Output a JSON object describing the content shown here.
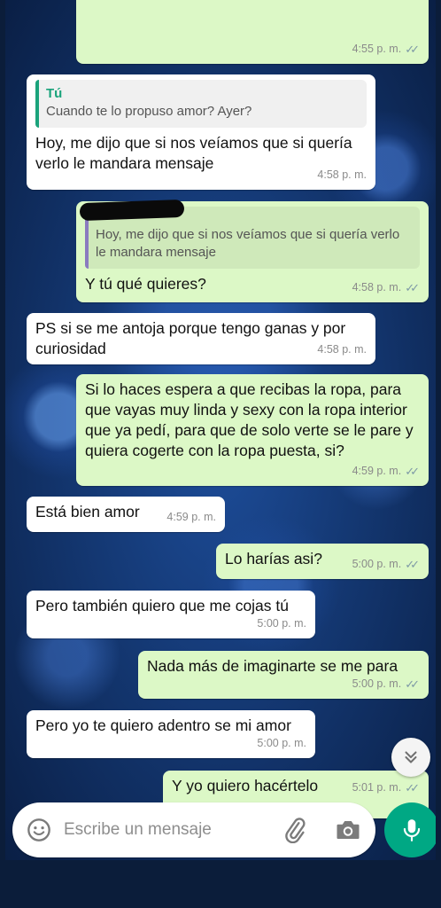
{
  "messages": [
    {
      "id": 0,
      "direction": "out",
      "text": "",
      "time": "4:55 p. m.",
      "partial": true
    },
    {
      "id": 1,
      "direction": "in",
      "quote": {
        "author": "Tú",
        "text": "Cuando te lo propuso amor? Ayer?"
      },
      "text": "Hoy, me dijo que si nos veíamos que si quería verlo le mandara mensaje",
      "time": "4:58 p. m."
    },
    {
      "id": 2,
      "direction": "out",
      "quote": {
        "author": "",
        "text": "Hoy, me dijo que si nos veíamos que si quería verlo le mandara mensaje",
        "author_redacted": true
      },
      "text": "Y tú qué quieres?",
      "time": "4:58 p. m."
    },
    {
      "id": 3,
      "direction": "in",
      "text": "PS si se me antoja porque tengo ganas y por curiosidad",
      "time": "4:58 p. m."
    },
    {
      "id": 4,
      "direction": "out",
      "text": "Si lo haces espera a que recibas la ropa, para que vayas muy linda y sexy con la ropa interior que ya pedí, para que de solo verte se le pare y quiera cogerte con la ropa puesta, si?",
      "time": "4:59 p. m."
    },
    {
      "id": 5,
      "direction": "in",
      "text": "Está bien amor",
      "time": "4:59 p. m."
    },
    {
      "id": 6,
      "direction": "out",
      "text": "Lo harías asi?",
      "time": "5:00 p. m."
    },
    {
      "id": 7,
      "direction": "in",
      "text": "Pero también quiero que me cojas tú",
      "time": "5:00 p. m."
    },
    {
      "id": 8,
      "direction": "out",
      "text": "Nada más de imaginarte se me para",
      "time": "5:00 p. m."
    },
    {
      "id": 9,
      "direction": "in",
      "text": "Pero yo te quiero adentro se mi amor",
      "time": "5:00 p. m."
    },
    {
      "id": 10,
      "direction": "out",
      "text": "Y yo quiero hacértelo",
      "time": "5:01 p. m.",
      "partial": true
    }
  ],
  "composer": {
    "placeholder": "Escribe un mensaje",
    "icons": [
      "emoji-icon",
      "attach-icon",
      "camera-icon",
      "mic-icon"
    ]
  },
  "scroll_button": {
    "icon": "chevron-double-down-icon"
  },
  "colors": {
    "incoming_bubble": "#ffffff",
    "outgoing_bubble": "#dcf8c6",
    "accent": "#00a884",
    "quote_author": "#1aa37b",
    "read_ticks": "#7e9aa6"
  }
}
